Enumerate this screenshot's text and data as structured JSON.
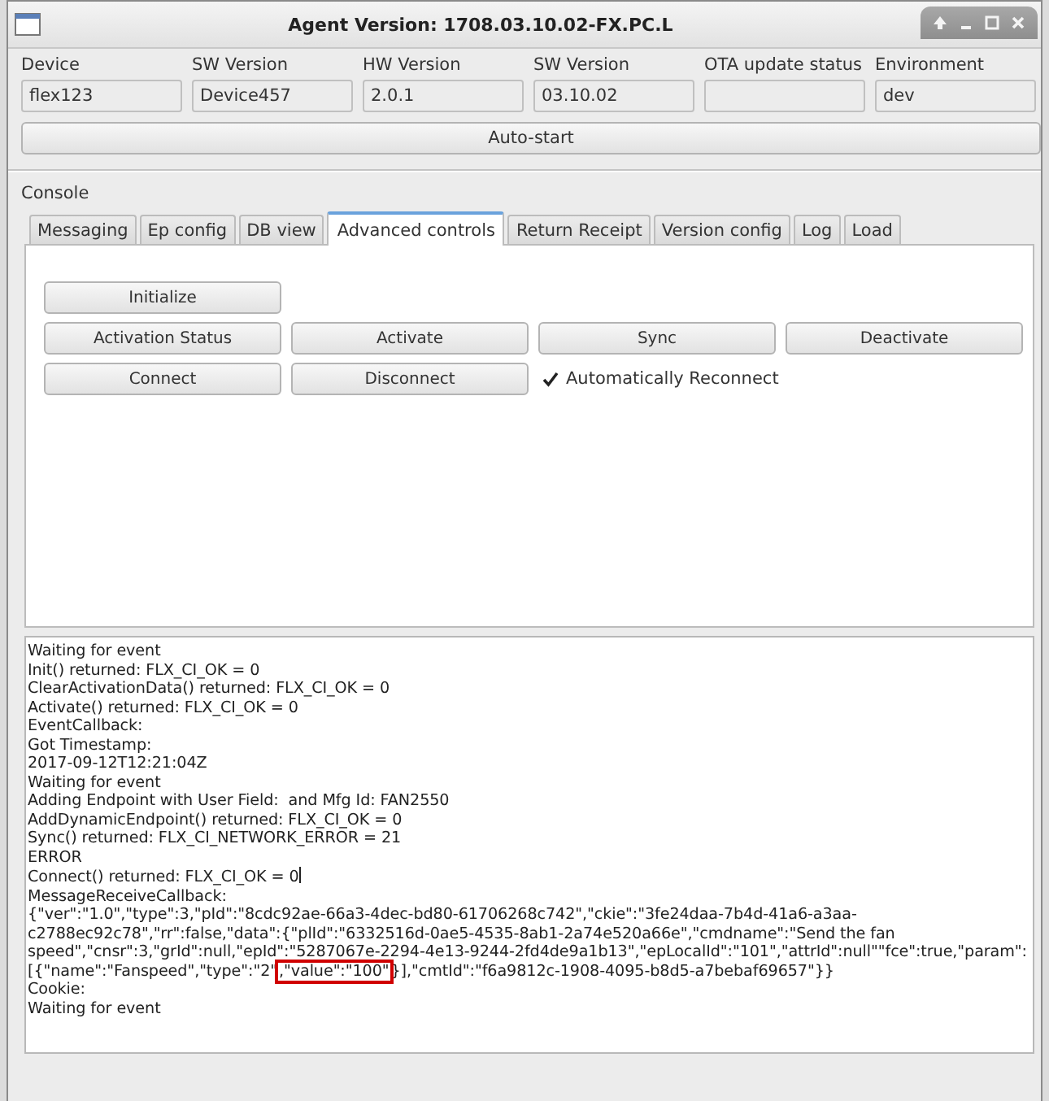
{
  "window": {
    "title": "Agent Version: 1708.03.10.02-FX.PC.L"
  },
  "info_fields": [
    {
      "label": "Device",
      "value": "flex123"
    },
    {
      "label": "SW Version",
      "value": "Device457"
    },
    {
      "label": "HW Version",
      "value": "2.0.1"
    },
    {
      "label": "SW Version",
      "value": "03.10.02"
    },
    {
      "label": "OTA update status"
    },
    {
      "label": "Environment",
      "value": "dev"
    }
  ],
  "auto_start_button": "Auto-start",
  "console": {
    "label": "Console",
    "tabs": [
      {
        "label": "Messaging",
        "selected": false
      },
      {
        "label": "Ep config",
        "selected": false
      },
      {
        "label": "DB view",
        "selected": false
      },
      {
        "label": "Advanced controls",
        "selected": true
      },
      {
        "label": "Return Receipt",
        "selected": false
      },
      {
        "label": "Version config",
        "selected": false
      },
      {
        "label": "Log",
        "selected": false
      },
      {
        "label": "Load",
        "selected": false
      }
    ],
    "control_rows": [
      [
        {
          "kind": "button",
          "label": "Initialize"
        }
      ],
      [
        {
          "kind": "button",
          "label": "Activation Status"
        },
        {
          "kind": "button",
          "label": "Activate"
        },
        {
          "kind": "button",
          "label": "Sync"
        },
        {
          "kind": "button",
          "label": "Deactivate"
        }
      ],
      [
        {
          "kind": "button",
          "label": "Connect"
        },
        {
          "kind": "button",
          "label": "Disconnect"
        },
        {
          "kind": "checkbox",
          "label": "Automatically Reconnect",
          "checked": true
        }
      ]
    ]
  },
  "log": {
    "lines": [
      {
        "kind": "plain",
        "text": "Waiting for event"
      },
      {
        "kind": "plain",
        "text": "Init() returned: FLX_CI_OK = 0"
      },
      {
        "kind": "plain",
        "text": "ClearActivationData() returned: FLX_CI_OK = 0"
      },
      {
        "kind": "plain",
        "text": "Activate() returned: FLX_CI_OK = 0"
      },
      {
        "kind": "plain",
        "text": "EventCallback:"
      },
      {
        "kind": "plain",
        "text": "Got Timestamp:"
      },
      {
        "kind": "plain",
        "text": "2017-09-12T12:21:04Z"
      },
      {
        "kind": "plain",
        "text": "Waiting for event"
      },
      {
        "kind": "plain",
        "text": "Adding Endpoint with User Field:  and Mfg Id: FAN2550"
      },
      {
        "kind": "plain",
        "text": "AddDynamicEndpoint() returned: FLX_CI_OK = 0"
      },
      {
        "kind": "plain",
        "text": "Sync() returned: FLX_CI_NETWORK_ERROR = 21"
      },
      {
        "kind": "plain",
        "text": "ERROR"
      },
      {
        "kind": "cursor",
        "text": "Connect() returned: FLX_CI_OK = 0"
      },
      {
        "kind": "plain",
        "text": "MessageReceiveCallback:"
      },
      {
        "kind": "plain",
        "text": "{\"ver\":\"1.0\",\"type\":3,\"pId\":\"8cdc92ae-66a3-4dec-bd80-61706268c742\",\"ckie\":\"3fe24daa-7b4d-41a6-a3aa-"
      },
      {
        "kind": "plain",
        "text": "c2788ec92c78\",\"rr\":false,\"data\":{\"plId\":\"6332516d-0ae5-4535-8ab1-2a74e520a66e\",\"cmdname\":\"Send the fan"
      },
      {
        "kind": "plain",
        "text": "speed\",\"cnsr\":3,\"grId\":null,\"epId\":\"5287067e-2294-4e13-9244-2fd4de9a1b13\",\"epLocalId\":\"101\",\"attrId\":null\"\"fce\":true,\"param\":"
      },
      {
        "kind": "highlight",
        "before": "[{\"name\":\"Fanspeed\",\"type\":\"2\"",
        "highlighted": ",\"value\":\"100\"",
        "after": "}],\"cmtId\":\"f6a9812c-1908-4095-b8d5-a7bebaf69657\"}}"
      },
      {
        "kind": "plain",
        "text": "Cookie:"
      },
      {
        "kind": "plain",
        "text": "Waiting for event"
      }
    ]
  }
}
